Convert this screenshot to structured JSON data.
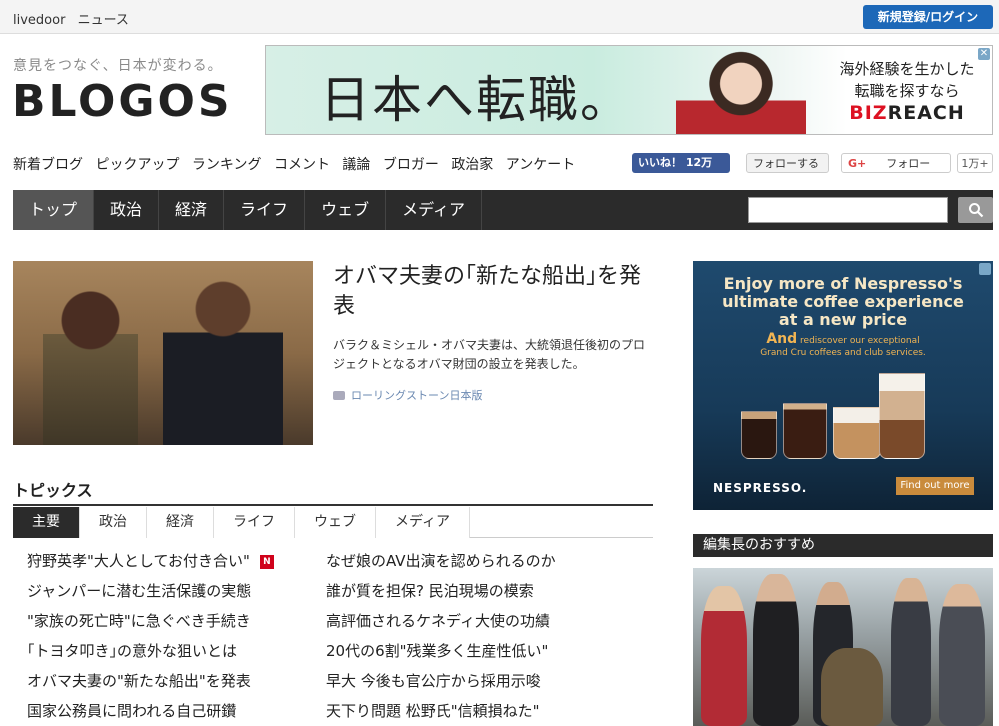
{
  "topbar": {
    "brand_name": "livedoor",
    "brand_section": "ニュース",
    "login_label": "新規登録/ログイン"
  },
  "header": {
    "tagline": "意見をつなぐ、日本が変わる。",
    "logo": "BLOGOS"
  },
  "top_ad": {
    "headline": "日本へ転職。",
    "copy_line1": "海外経験を生かした",
    "copy_line2": "転職を探すなら",
    "brand_prefix": "BIZ",
    "brand_suffix": "REACH",
    "close_glyph": "✕"
  },
  "subnav": {
    "items": [
      "新着ブログ",
      "ピックアップ",
      "ランキング",
      "コメント",
      "議論",
      "ブロガー",
      "政治家",
      "アンケート"
    ]
  },
  "social": {
    "facebook_label": "いいね！ 12万",
    "twitter_label": "フォローする",
    "gplus_prefix": "G+",
    "gplus_label": "フォロー",
    "gplus_count": "1万+"
  },
  "mainnav": {
    "tabs": [
      "トップ",
      "政治",
      "経済",
      "ライフ",
      "ウェブ",
      "メディア"
    ],
    "active_index": 0
  },
  "search": {
    "placeholder": ""
  },
  "feature": {
    "title": "オバマ夫妻の｢新たな船出｣を発表",
    "description": "バラク＆ミシェル・オバマ夫妻は、大統領退任後初のプロジェクトとなるオバマ財団の設立を発表した。",
    "source": "ローリングストーン日本版"
  },
  "topics": {
    "heading": "トピックス",
    "tabs": [
      "主要",
      "政治",
      "経済",
      "ライフ",
      "ウェブ",
      "メディア"
    ],
    "active_index": 0,
    "new_badge": "N",
    "left": [
      "狩野英孝\"大人としてお付き合い\"",
      "ジャンパーに潜む生活保護の実態",
      "\"家族の死亡時\"に急ぐべき手続き",
      "｢トヨタ叩き｣の意外な狙いとは",
      "オバマ夫妻の\"新たな船出\"を発表",
      "国家公務員に問われる自己研鑽"
    ],
    "right": [
      "なぜ娘のAV出演を認められるのか",
      "誰が質を担保? 民泊現場の模索",
      "高評価されるケネディ大使の功績",
      "20代の6割\"残業多く生産性低い\"",
      "早大 今後も官公庁から採用示唆",
      "天下り問題 松野氏\"信頼損ねた\""
    ]
  },
  "side_ad": {
    "headline_line1": "Enjoy more of Nespresso's",
    "headline_line2": "ultimate coffee experience",
    "headline_line3": "at a new price",
    "sub_lead": "And",
    "sub_line1": "rediscover our exceptional",
    "sub_line2": "Grand Cru coffees and club services.",
    "brand": "NESPRESSO.",
    "cta": "Find out more"
  },
  "editor": {
    "heading": "編集長のおすすめ"
  },
  "colors": {
    "accent_blue": "#1d68b8",
    "nav_dark": "#2b2b2b",
    "facebook": "#3b5998",
    "new_badge": "#d0021b"
  }
}
